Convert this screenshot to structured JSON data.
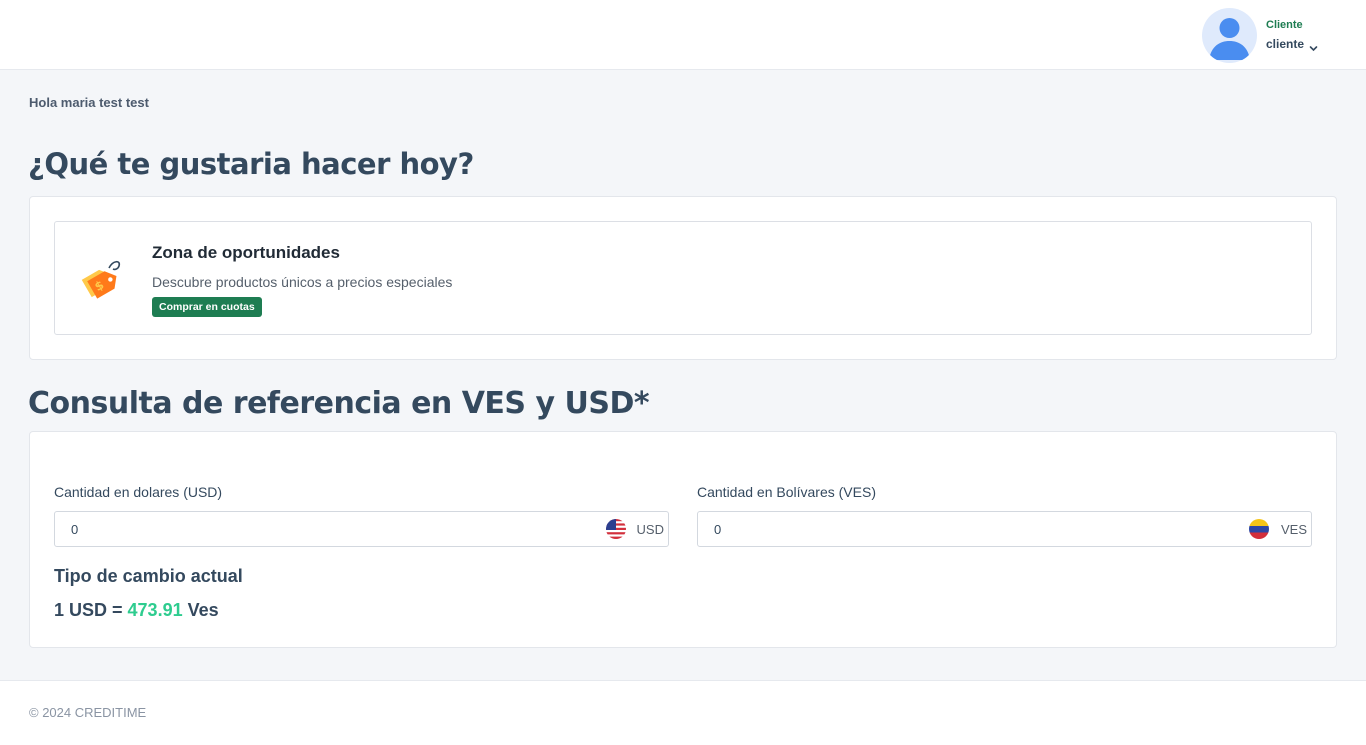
{
  "header": {
    "user_role": "Cliente",
    "user_name": "cliente",
    "icons": [
      "avatar-icon",
      "chevron-down-icon"
    ]
  },
  "greeting": "Hola maria test test",
  "section1": {
    "title": "¿Qué te gustaria hacer hoy?",
    "promo": {
      "icon": "price-tag-icon",
      "title": "Zona de oportunidades",
      "description": "Descubre productos únicos a precios especiales",
      "button_label": "Comprar en cuotas"
    }
  },
  "section2": {
    "title": "Consulta de referencia en VES y USD*",
    "usd": {
      "label": "Cantidad en dolares (USD)",
      "value": "0",
      "currency": "USD",
      "flag_icon": "us-flag-icon"
    },
    "ves": {
      "label": "Cantidad en Bolívares (VES)",
      "value": "0",
      "currency": "VES",
      "flag_icon": "venezuela-flag-icon"
    },
    "rate": {
      "title": "Tipo de cambio actual",
      "prefix": "1 USD = ",
      "value": "473.91",
      "suffix": " Ves"
    }
  },
  "footer": {
    "text": "© 2024 CREDITIME"
  },
  "colors": {
    "accent_green": "#1e7d52",
    "rate_green": "#2ecc8f",
    "title_text": "#34495e",
    "background": "#f4f6f9"
  }
}
